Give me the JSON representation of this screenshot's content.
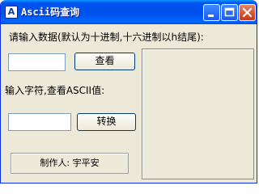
{
  "window": {
    "title": "Ascii码查询",
    "app_icon": "app-icon",
    "controls": [
      "minimize-icon",
      "maximize-icon",
      "close-icon"
    ]
  },
  "main": {
    "prompt_number": "请输入数据(默认为十进制,十六进制以h结尾):",
    "number_input_value": "",
    "query_button": "查看",
    "prompt_char": "输入字符,查看ASCII值:",
    "char_input_value": "",
    "convert_button": "转换",
    "author": "制作人: 宇平安",
    "result_text": ""
  }
}
